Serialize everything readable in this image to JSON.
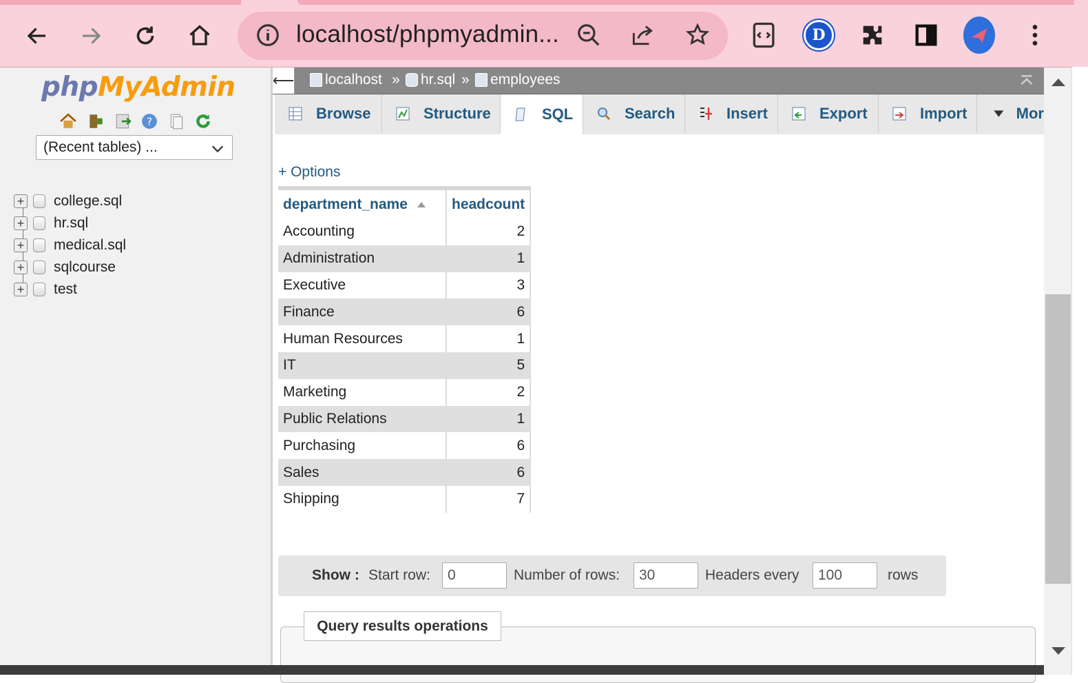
{
  "browser": {
    "url": "localhost/phpmyadmin...",
    "extension_badge": "D"
  },
  "sidebar": {
    "logo_php": "php",
    "logo_rest": "MyAdmin",
    "recent_tables": "(Recent tables) ...",
    "databases": [
      "college.sql",
      "hr.sql",
      "medical.sql",
      "sqlcourse",
      "test"
    ]
  },
  "breadcrumb": {
    "server": "localhost",
    "database": "hr.sql",
    "table": "employees",
    "separator": "»"
  },
  "tabs": [
    "Browse",
    "Structure",
    "SQL",
    "Search",
    "Insert",
    "Export",
    "Import",
    "Mor"
  ],
  "active_tab": "SQL",
  "options_link": "+ Options",
  "results": {
    "columns": [
      "department_name",
      "headcount"
    ],
    "rows": [
      [
        "Accounting",
        "2"
      ],
      [
        "Administration",
        "1"
      ],
      [
        "Executive",
        "3"
      ],
      [
        "Finance",
        "6"
      ],
      [
        "Human Resources",
        "1"
      ],
      [
        "IT",
        "5"
      ],
      [
        "Marketing",
        "2"
      ],
      [
        "Public Relations",
        "1"
      ],
      [
        "Purchasing",
        "6"
      ],
      [
        "Sales",
        "6"
      ],
      [
        "Shipping",
        "7"
      ]
    ]
  },
  "show_bar": {
    "show_label": "Show :",
    "start_row_label": "Start row:",
    "start_row_value": "0",
    "num_rows_label": "Number of rows:",
    "num_rows_value": "30",
    "headers_label": "Headers every",
    "headers_value": "100",
    "rows_label": "rows"
  },
  "query_ops": "Query results operations"
}
